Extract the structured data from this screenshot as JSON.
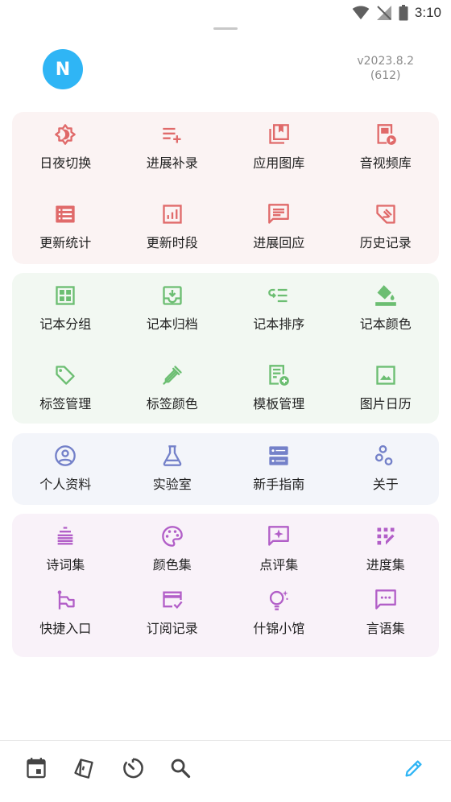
{
  "status": {
    "time": "3:10"
  },
  "profile": {
    "avatar_letter": "N",
    "version": "v2023.8.2",
    "build": "(612)"
  },
  "colors": {
    "red": "#e06a6a",
    "green": "#6cbe72",
    "blue": "#7481c9",
    "purple": "#b25fc8",
    "accent": "#2fb5f5"
  },
  "groups": {
    "red": [
      {
        "label": "日夜切换",
        "icon": "day-night-icon"
      },
      {
        "label": "进展补录",
        "icon": "playlist-add-icon"
      },
      {
        "label": "应用图库",
        "icon": "library-icon"
      },
      {
        "label": "音视频库",
        "icon": "video-library-icon"
      },
      {
        "label": "更新统计",
        "icon": "list-stats-icon"
      },
      {
        "label": "更新时段",
        "icon": "bar-chart-icon"
      },
      {
        "label": "进展回应",
        "icon": "reply-message-icon"
      },
      {
        "label": "历史记录",
        "icon": "history-icon"
      }
    ],
    "green": [
      {
        "label": "记本分组",
        "icon": "grid-icon"
      },
      {
        "label": "记本归档",
        "icon": "archive-icon"
      },
      {
        "label": "记本排序",
        "icon": "sort-icon"
      },
      {
        "label": "记本颜色",
        "icon": "paint-bucket-icon"
      },
      {
        "label": "标签管理",
        "icon": "tag-icon"
      },
      {
        "label": "标签颜色",
        "icon": "eyedropper-icon"
      },
      {
        "label": "模板管理",
        "icon": "template-add-icon"
      },
      {
        "label": "图片日历",
        "icon": "image-icon"
      }
    ],
    "blue": [
      {
        "label": "个人资料",
        "icon": "account-circle-icon"
      },
      {
        "label": "实验室",
        "icon": "flask-icon"
      },
      {
        "label": "新手指南",
        "icon": "guide-icon"
      },
      {
        "label": "关于",
        "icon": "about-icon"
      }
    ],
    "purple": [
      {
        "label": "诗词集",
        "icon": "poem-lines-icon"
      },
      {
        "label": "颜色集",
        "icon": "palette-icon"
      },
      {
        "label": "点评集",
        "icon": "review-icon"
      },
      {
        "label": "进度集",
        "icon": "progress-icon"
      },
      {
        "label": "快捷入口",
        "icon": "flag-route-icon"
      },
      {
        "label": "订阅记录",
        "icon": "card-check-icon"
      },
      {
        "label": "什锦小馆",
        "icon": "lightbulb-icon"
      },
      {
        "label": "言语集",
        "icon": "chat-icon"
      }
    ]
  },
  "bottom_nav": [
    {
      "icon": "calendar-icon"
    },
    {
      "icon": "cards-icon"
    },
    {
      "icon": "timer-icon"
    },
    {
      "icon": "search-icon"
    },
    {
      "icon": "edit-icon"
    }
  ]
}
